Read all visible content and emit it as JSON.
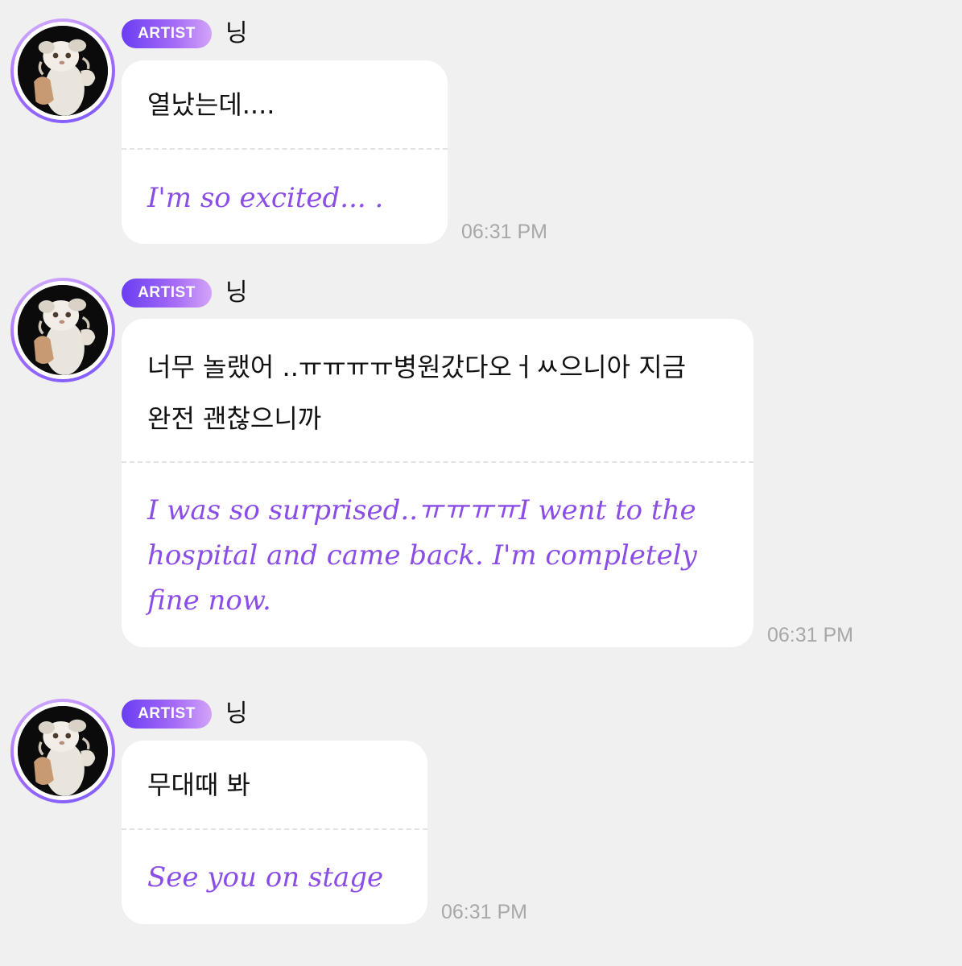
{
  "messages": [
    {
      "badge": "ARTIST",
      "name": "닝",
      "text_ko": "열났는데....",
      "text_en": "I'm so excited... .",
      "time": "06:31 PM",
      "avatar": "white-cat-avatar"
    },
    {
      "badge": "ARTIST",
      "name": "닝",
      "text_ko": "너무 놀랬어 ..ㅠㅠㅠㅠ병원갔다오ㅓㅆ으니아 지금 완전 괜찮으니까",
      "text_en": "I was so surprised..ㅠㅠㅠㅠI went to the hospital and came back. I'm completely fine now.",
      "time": "06:31 PM",
      "avatar": "white-cat-avatar"
    },
    {
      "badge": "ARTIST",
      "name": "닝",
      "text_ko": "무대때 봐",
      "text_en": "See you on stage",
      "time": "06:31 PM",
      "avatar": "white-cat-avatar"
    }
  ],
  "colors": {
    "background": "#f0f0f0",
    "bubble": "#ffffff",
    "translation_text": "#8a4de6",
    "badge_gradient_start": "#6a3df2",
    "badge_gradient_end": "#d2a4f8",
    "timestamp": "#a8a8a8"
  }
}
